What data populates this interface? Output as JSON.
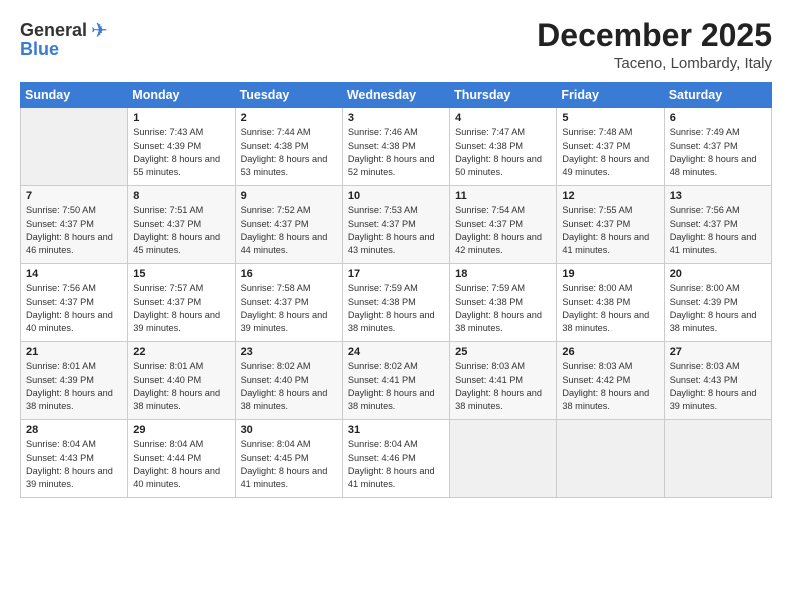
{
  "logo": {
    "general": "General",
    "blue": "Blue"
  },
  "title": "December 2025",
  "subtitle": "Taceno, Lombardy, Italy",
  "weekdays": [
    "Sunday",
    "Monday",
    "Tuesday",
    "Wednesday",
    "Thursday",
    "Friday",
    "Saturday"
  ],
  "weeks": [
    [
      {
        "day": "",
        "empty": true
      },
      {
        "day": "1",
        "sunrise": "7:43 AM",
        "sunset": "4:39 PM",
        "daylight": "8 hours and 55 minutes."
      },
      {
        "day": "2",
        "sunrise": "7:44 AM",
        "sunset": "4:38 PM",
        "daylight": "8 hours and 53 minutes."
      },
      {
        "day": "3",
        "sunrise": "7:46 AM",
        "sunset": "4:38 PM",
        "daylight": "8 hours and 52 minutes."
      },
      {
        "day": "4",
        "sunrise": "7:47 AM",
        "sunset": "4:38 PM",
        "daylight": "8 hours and 50 minutes."
      },
      {
        "day": "5",
        "sunrise": "7:48 AM",
        "sunset": "4:37 PM",
        "daylight": "8 hours and 49 minutes."
      },
      {
        "day": "6",
        "sunrise": "7:49 AM",
        "sunset": "4:37 PM",
        "daylight": "8 hours and 48 minutes."
      }
    ],
    [
      {
        "day": "7",
        "sunrise": "7:50 AM",
        "sunset": "4:37 PM",
        "daylight": "8 hours and 46 minutes."
      },
      {
        "day": "8",
        "sunrise": "7:51 AM",
        "sunset": "4:37 PM",
        "daylight": "8 hours and 45 minutes."
      },
      {
        "day": "9",
        "sunrise": "7:52 AM",
        "sunset": "4:37 PM",
        "daylight": "8 hours and 44 minutes."
      },
      {
        "day": "10",
        "sunrise": "7:53 AM",
        "sunset": "4:37 PM",
        "daylight": "8 hours and 43 minutes."
      },
      {
        "day": "11",
        "sunrise": "7:54 AM",
        "sunset": "4:37 PM",
        "daylight": "8 hours and 42 minutes."
      },
      {
        "day": "12",
        "sunrise": "7:55 AM",
        "sunset": "4:37 PM",
        "daylight": "8 hours and 41 minutes."
      },
      {
        "day": "13",
        "sunrise": "7:56 AM",
        "sunset": "4:37 PM",
        "daylight": "8 hours and 41 minutes."
      }
    ],
    [
      {
        "day": "14",
        "sunrise": "7:56 AM",
        "sunset": "4:37 PM",
        "daylight": "8 hours and 40 minutes."
      },
      {
        "day": "15",
        "sunrise": "7:57 AM",
        "sunset": "4:37 PM",
        "daylight": "8 hours and 39 minutes."
      },
      {
        "day": "16",
        "sunrise": "7:58 AM",
        "sunset": "4:37 PM",
        "daylight": "8 hours and 39 minutes."
      },
      {
        "day": "17",
        "sunrise": "7:59 AM",
        "sunset": "4:38 PM",
        "daylight": "8 hours and 38 minutes."
      },
      {
        "day": "18",
        "sunrise": "7:59 AM",
        "sunset": "4:38 PM",
        "daylight": "8 hours and 38 minutes."
      },
      {
        "day": "19",
        "sunrise": "8:00 AM",
        "sunset": "4:38 PM",
        "daylight": "8 hours and 38 minutes."
      },
      {
        "day": "20",
        "sunrise": "8:00 AM",
        "sunset": "4:39 PM",
        "daylight": "8 hours and 38 minutes."
      }
    ],
    [
      {
        "day": "21",
        "sunrise": "8:01 AM",
        "sunset": "4:39 PM",
        "daylight": "8 hours and 38 minutes."
      },
      {
        "day": "22",
        "sunrise": "8:01 AM",
        "sunset": "4:40 PM",
        "daylight": "8 hours and 38 minutes."
      },
      {
        "day": "23",
        "sunrise": "8:02 AM",
        "sunset": "4:40 PM",
        "daylight": "8 hours and 38 minutes."
      },
      {
        "day": "24",
        "sunrise": "8:02 AM",
        "sunset": "4:41 PM",
        "daylight": "8 hours and 38 minutes."
      },
      {
        "day": "25",
        "sunrise": "8:03 AM",
        "sunset": "4:41 PM",
        "daylight": "8 hours and 38 minutes."
      },
      {
        "day": "26",
        "sunrise": "8:03 AM",
        "sunset": "4:42 PM",
        "daylight": "8 hours and 38 minutes."
      },
      {
        "day": "27",
        "sunrise": "8:03 AM",
        "sunset": "4:43 PM",
        "daylight": "8 hours and 39 minutes."
      }
    ],
    [
      {
        "day": "28",
        "sunrise": "8:04 AM",
        "sunset": "4:43 PM",
        "daylight": "8 hours and 39 minutes."
      },
      {
        "day": "29",
        "sunrise": "8:04 AM",
        "sunset": "4:44 PM",
        "daylight": "8 hours and 40 minutes."
      },
      {
        "day": "30",
        "sunrise": "8:04 AM",
        "sunset": "4:45 PM",
        "daylight": "8 hours and 41 minutes."
      },
      {
        "day": "31",
        "sunrise": "8:04 AM",
        "sunset": "4:46 PM",
        "daylight": "8 hours and 41 minutes."
      },
      {
        "day": "",
        "empty": true
      },
      {
        "day": "",
        "empty": true
      },
      {
        "day": "",
        "empty": true
      }
    ]
  ]
}
